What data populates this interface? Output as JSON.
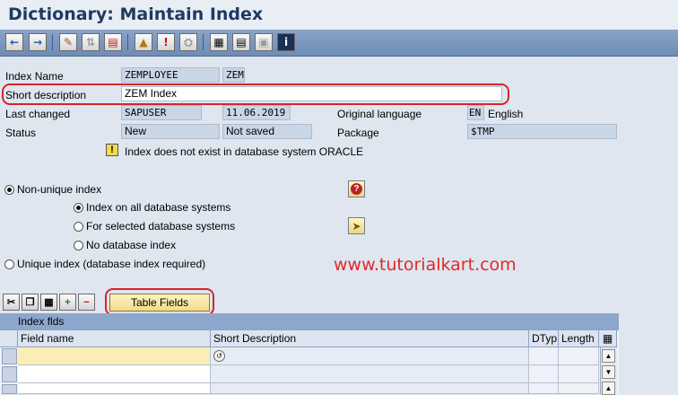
{
  "title": "Dictionary: Maintain Index",
  "toolbar": {
    "icons": [
      "back-icon",
      "forward-icon",
      "display-change-icon",
      "active-inactive-icon",
      "other-object-icon",
      "check-icon",
      "activate-icon",
      "where-used-icon",
      "object-list-icon",
      "table-fields-icon",
      "print-icon",
      "info-icon"
    ]
  },
  "form": {
    "index_name_label": "Index Name",
    "index_name_value": "ZEMPLOYEE",
    "index_id_value": "ZEM",
    "short_desc_label": "Short description",
    "short_desc_value": "ZEM Index",
    "last_changed_label": "Last changed",
    "last_changed_user": "SAPUSER",
    "last_changed_date": "11.06.2019",
    "orig_lang_label": "Original language",
    "orig_lang_code": "EN",
    "orig_lang_name": "English",
    "status_label": "Status",
    "status_value": "New",
    "saved_value": "Not saved",
    "package_label": "Package",
    "package_value": "$TMP",
    "warning_text": "Index does not exist in database system ORACLE"
  },
  "options": {
    "non_unique": "Non-unique index",
    "all_db": "Index on all database systems",
    "selected_db": "For selected database systems",
    "no_db": "No database index",
    "unique": "Unique index (database index required)"
  },
  "watermark": "www.tutorialkart.com",
  "table": {
    "button_label": "Table Fields",
    "section_title": "Index flds",
    "columns": [
      "Field name",
      "Short Description",
      "DTyp",
      "Length"
    ]
  },
  "colors": {
    "highlight": "#d8232a",
    "header_blue": "#8ca6cc",
    "input_yellow": "#fbeeb4"
  }
}
